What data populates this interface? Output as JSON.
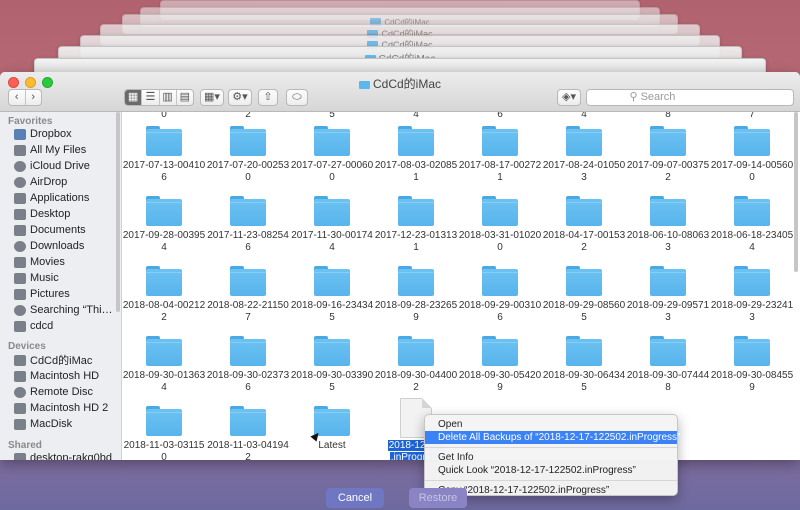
{
  "stack_title": "CdCd的iMac",
  "window": {
    "title": "CdCd的iMac"
  },
  "toolbar": {
    "back": "‹",
    "forward": "›",
    "views": [
      "▦",
      "☰",
      "▥",
      "▤"
    ],
    "arrange": "▦▾",
    "action": "⚙▾",
    "share": "⇧",
    "tag": "⬭",
    "dropbox": "◈▾",
    "search_placeholder": "Search"
  },
  "sidebar": {
    "favorites_header": "Favorites",
    "favorites": [
      {
        "label": "Dropbox",
        "icon": "dropbox-icon"
      },
      {
        "label": "All My Files",
        "icon": "all-files-icon"
      },
      {
        "label": "iCloud Drive",
        "icon": "cloud-icon"
      },
      {
        "label": "AirDrop",
        "icon": "airdrop-icon"
      },
      {
        "label": "Applications",
        "icon": "applications-icon"
      },
      {
        "label": "Desktop",
        "icon": "desktop-icon"
      },
      {
        "label": "Documents",
        "icon": "documents-icon"
      },
      {
        "label": "Downloads",
        "icon": "downloads-icon"
      },
      {
        "label": "Movies",
        "icon": "movies-icon"
      },
      {
        "label": "Music",
        "icon": "music-icon"
      },
      {
        "label": "Pictures",
        "icon": "pictures-icon"
      },
      {
        "label": "Searching “This Ma...",
        "icon": "gear-icon"
      },
      {
        "label": "cdcd",
        "icon": "home-icon"
      }
    ],
    "devices_header": "Devices",
    "devices": [
      {
        "label": "CdCd的iMac",
        "icon": "imac-icon"
      },
      {
        "label": "Macintosh HD",
        "icon": "disk-icon"
      },
      {
        "label": "Remote Disc",
        "icon": "disc-icon"
      },
      {
        "label": "Macintosh HD 2",
        "icon": "disk-icon"
      },
      {
        "label": "MacDisk",
        "icon": "disk-icon"
      }
    ],
    "shared_header": "Shared",
    "shared": [
      {
        "label": "desktop-rakg0bd",
        "icon": "network-computer-icon"
      }
    ]
  },
  "grid": {
    "row0": [
      "0",
      "2",
      "5",
      "4",
      "6",
      "4",
      "8",
      "7"
    ],
    "rows": [
      [
        [
          "2017-07-13-00410",
          "6"
        ],
        [
          "2017-07-20-00253",
          "0"
        ],
        [
          "2017-07-27-00060",
          "0"
        ],
        [
          "2017-08-03-02085",
          "1"
        ],
        [
          "2017-08-17-002721",
          ""
        ],
        [
          "2017-08-24-01050",
          "3"
        ],
        [
          "2017-09-07-00375",
          "2"
        ],
        [
          "2017-09-14-00560",
          "0"
        ]
      ],
      [
        [
          "2017-09-28-00395",
          "4"
        ],
        [
          "2017-11-23-08254",
          "6"
        ],
        [
          "2017-11-30-001744",
          ""
        ],
        [
          "2017-12-23-013131",
          ""
        ],
        [
          "2018-03-31-01020",
          "0"
        ],
        [
          "2018-04-17-00153",
          "2"
        ],
        [
          "2018-06-10-08063",
          "3"
        ],
        [
          "2018-06-18-23405",
          "4"
        ]
      ],
      [
        [
          "2018-08-04-00212",
          "2"
        ],
        [
          "2018-08-22-21150",
          "7"
        ],
        [
          "2018-09-16-23434",
          "5"
        ],
        [
          "2018-09-28-23265",
          "9"
        ],
        [
          "2018-09-29-00310",
          "6"
        ],
        [
          "2018-09-29-08560",
          "5"
        ],
        [
          "2018-09-29-09571",
          "3"
        ],
        [
          "2018-09-29-23241",
          "3"
        ]
      ],
      [
        [
          "2018-09-30-01363",
          "4"
        ],
        [
          "2018-09-30-02373",
          "6"
        ],
        [
          "2018-09-30-03390",
          "5"
        ],
        [
          "2018-09-30-04400",
          "2"
        ],
        [
          "2018-09-30-05420",
          "9"
        ],
        [
          "2018-09-30-06434",
          "5"
        ],
        [
          "2018-09-30-07444",
          "8"
        ],
        [
          "2018-09-30-08455",
          "9"
        ]
      ],
      [
        [
          "2018-11-03-031150",
          ""
        ],
        [
          "2018-11-03-04194",
          "2"
        ],
        [
          "Latest",
          ""
        ]
      ]
    ],
    "selected_label_1": "2018-12-17-",
    "selected_label_2": ".inProgress"
  },
  "context_menu": {
    "open": "Open",
    "delete": "Delete All Backups of “2018-12-17-122502.inProgress”",
    "get_info": "Get Info",
    "quick_look": "Quick Look “2018-12-17-122502.inProgress”",
    "copy": "Copy “2018-12-17-122502.inProgress”"
  },
  "buttons": {
    "cancel": "Cancel",
    "restore": "Restore"
  }
}
